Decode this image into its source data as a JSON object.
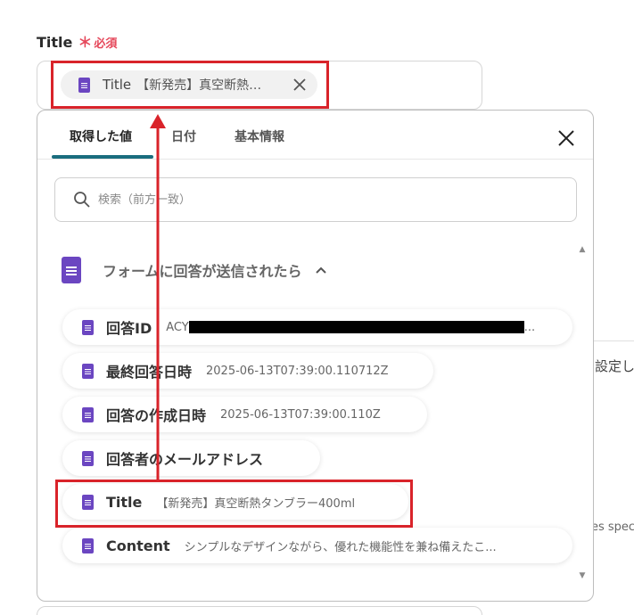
{
  "field": {
    "label": "Title",
    "required_star": "＊",
    "required_text": "必須"
  },
  "selected_chip": {
    "key": "Title",
    "value": "【新発売】真空断熱…"
  },
  "panel": {
    "tabs": [
      {
        "label": "取得した値",
        "active": true
      },
      {
        "label": "日付",
        "active": false
      },
      {
        "label": "基本情報",
        "active": false
      }
    ],
    "search_placeholder": "検索（前方一致）",
    "group_title": "フォームに回答が送信されたら",
    "items": [
      {
        "label": "回答ID",
        "value_prefix": "ACY",
        "value_suffix": "..."
      },
      {
        "label": "最終回答日時",
        "value": "2025-06-13T07:39:00.110712Z"
      },
      {
        "label": "回答の作成日時",
        "value": "2025-06-13T07:39:00.110Z"
      },
      {
        "label": "回答者のメールアドレス",
        "value": ""
      },
      {
        "label": "Title",
        "value": "【新発売】真空断熱タンブラー400ml"
      },
      {
        "label": "Content",
        "value": "シンプルなデザインながら、優れた機能性を兼ね備えたこ..."
      }
    ]
  },
  "background": {
    "side_text_1": "設定し",
    "side_text_2": "es spec"
  },
  "colors": {
    "accent": "#1a6d7e",
    "icon_purple": "#6b46c1",
    "required_red": "#e5475a",
    "highlight_red": "#d9232a"
  }
}
